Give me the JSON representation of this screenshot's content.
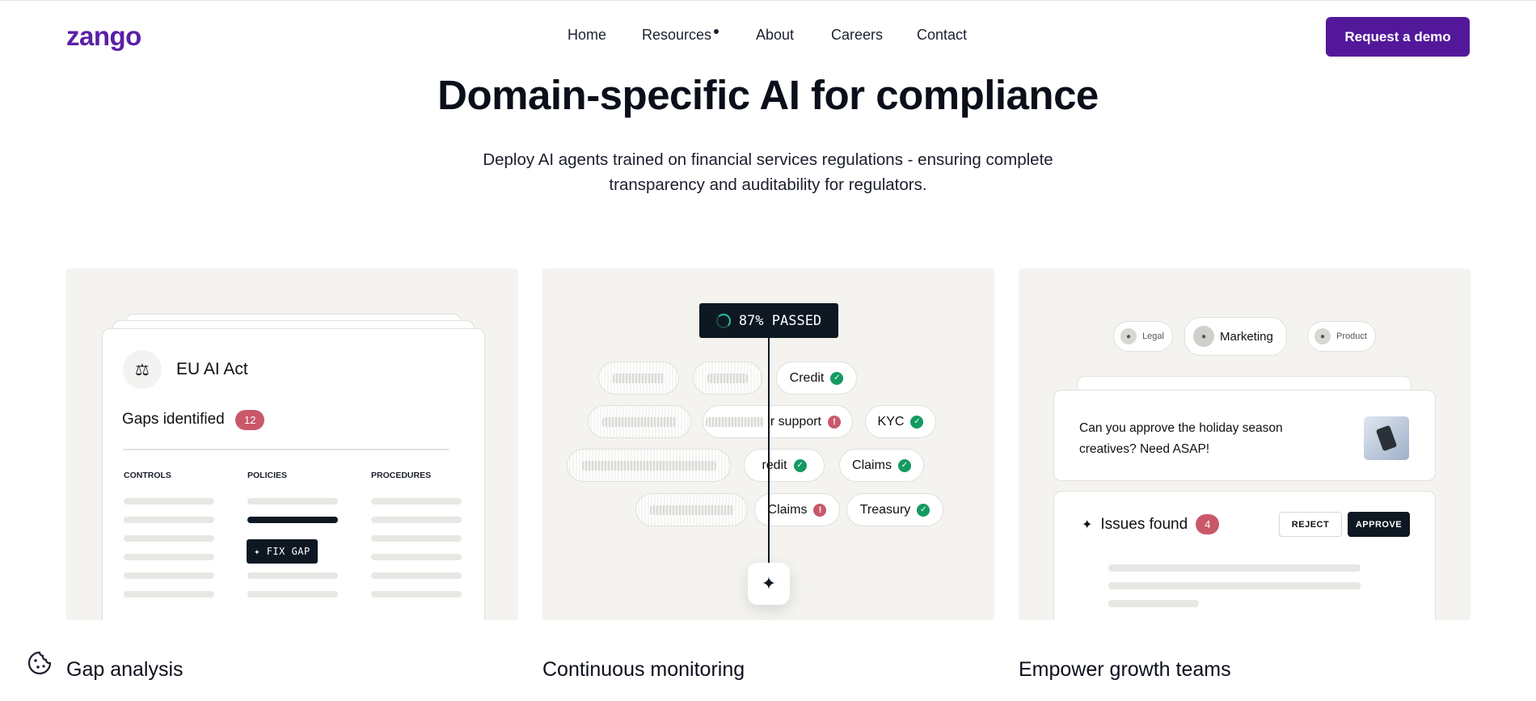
{
  "brand": {
    "logo": "zango",
    "accent": "#53189a"
  },
  "nav": {
    "items": [
      "Home",
      "Resources",
      "About",
      "Careers",
      "Contact"
    ],
    "cta": "Request a demo"
  },
  "hero": {
    "title": "Domain-specific AI for compliance",
    "subtitle": "Deploy AI agents trained on financial services regulations - ensuring complete transparency and auditability for regulators."
  },
  "gap_panel": {
    "card_title": "EU AI Act",
    "gaps_label": "Gaps identified",
    "gaps_count": "12",
    "columns": [
      "CONTROLS",
      "POLICIES",
      "PROCEDURES"
    ],
    "fix_button": "FIX GAP",
    "icon": "scale-icon"
  },
  "monitor_panel": {
    "status": "87% PASSED",
    "pills": [
      {
        "label": "Credit",
        "state": "pass"
      },
      {
        "label": "r support",
        "state": "warn"
      },
      {
        "label": "KYC",
        "state": "pass"
      },
      {
        "label": "redit",
        "state": "pass"
      },
      {
        "label": "Claims",
        "state": "pass"
      },
      {
        "label": "Claims",
        "state": "warn"
      },
      {
        "label": "Treasury",
        "state": "pass"
      }
    ]
  },
  "growth_panel": {
    "teams": [
      "Legal",
      "Marketing",
      "Product"
    ],
    "message": "Can you approve the holiday season creatives? Need ASAP!",
    "issues_label": "Issues found",
    "issues_count": "4",
    "reject": "REJECT",
    "approve": "APPROVE"
  },
  "captions": [
    "Gap analysis",
    "Continuous monitoring",
    "Empower growth teams"
  ],
  "colors": {
    "pass": "#149a62",
    "warn": "#c9586a",
    "dark": "#0e1822",
    "panel_bg": "#f4f3ef"
  }
}
